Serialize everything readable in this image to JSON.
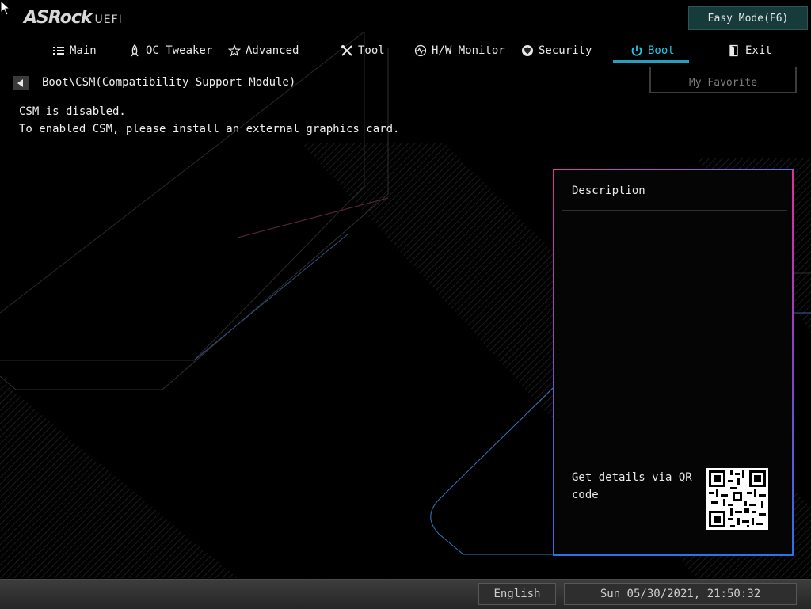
{
  "header": {
    "logo_main": "ASRock",
    "logo_sub": "UEFI",
    "easy_mode_label": "Easy Mode(F6)"
  },
  "nav": {
    "tabs": [
      {
        "label": "Main",
        "icon": "list-icon"
      },
      {
        "label": "OC Tweaker",
        "icon": "rocket-icon"
      },
      {
        "label": "Advanced",
        "icon": "star-icon"
      },
      {
        "label": "Tool",
        "icon": "tools-icon"
      },
      {
        "label": "H/W Monitor",
        "icon": "monitor-icon"
      },
      {
        "label": "Security",
        "icon": "shield-icon"
      },
      {
        "label": "Boot",
        "icon": "power-icon"
      },
      {
        "label": "Exit",
        "icon": "exit-icon"
      }
    ],
    "active": "Boot"
  },
  "breadcrumb": "Boot\\CSM(Compatibility Support Module)",
  "my_favorite_label": "My Favorite",
  "messages": [
    "CSM is disabled.",
    "To enabled CSM, please install an external graphics card."
  ],
  "description": {
    "title": "Description",
    "qr_text": "Get details via QR code"
  },
  "footer": {
    "language": "English",
    "datetime": "Sun 05/30/2021, 21:50:32"
  },
  "colors": {
    "accent": "#27c4e6",
    "easy_mode_bg": "#173a3a"
  }
}
